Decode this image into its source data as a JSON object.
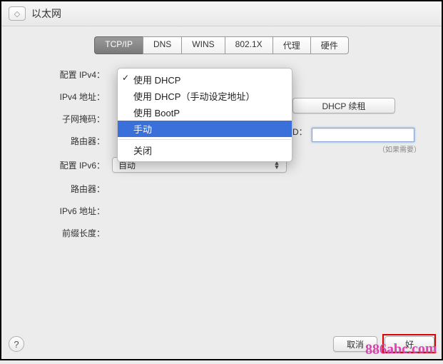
{
  "window": {
    "title": "以太网"
  },
  "tabs": {
    "items": [
      "TCP/IP",
      "DNS",
      "WINS",
      "802.1X",
      "代理",
      "硬件"
    ],
    "active_index": 0
  },
  "dropdown": {
    "items": [
      {
        "label": "使用 DHCP",
        "checked": true,
        "highlighted": false
      },
      {
        "label": "使用 DHCP（手动设定地址）",
        "checked": false,
        "highlighted": false
      },
      {
        "label": "使用 BootP",
        "checked": false,
        "highlighted": false
      },
      {
        "label": "手动",
        "checked": false,
        "highlighted": true
      }
    ],
    "footer_item": {
      "label": "关闭"
    }
  },
  "labels": {
    "config_ipv4": "配置 IPv4：",
    "ipv4_addr": "IPv4 地址：",
    "subnet": "子网掩码：",
    "router": "路由器：",
    "config_ipv6": "配置 IPv6：",
    "router6": "路由器：",
    "ipv6_addr": "IPv6 地址：",
    "prefix_len": "前缀长度：",
    "client_id_suffix": "D："
  },
  "values": {
    "ipv6_select": "自动",
    "client_id_value": ""
  },
  "buttons": {
    "dhcp_renew": "DHCP 续租",
    "cancel": "取消",
    "ok": "好"
  },
  "hints": {
    "if_needed": "（如果需要）"
  },
  "watermark": "886abc.com"
}
